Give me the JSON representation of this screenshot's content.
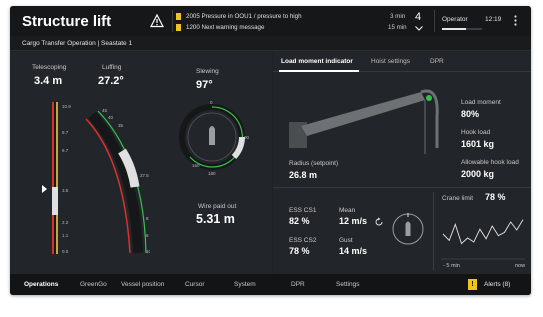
{
  "header": {
    "title": "Structure lift",
    "alerts": [
      {
        "text": "2005 Pressure in OOU1 / pressure to high",
        "time": "3 min"
      },
      {
        "text": "1200 Next warning message",
        "time": "15 min"
      }
    ],
    "alert_count": "4",
    "role": "Operator",
    "clock": "12:19"
  },
  "subheader": {
    "operation": "Cargo Transfer Operation | Seastate 1"
  },
  "telescoping": {
    "label": "Telescoping",
    "value": "3.4 m",
    "ticks": [
      "10.9",
      "8.7",
      "6.7",
      "3.5",
      "2.2",
      "1.1",
      "0.0"
    ]
  },
  "luffing": {
    "label": "Luffing",
    "value": "27.2°",
    "ticks": [
      "45",
      "40",
      "35",
      "27.5",
      "8",
      "6",
      "10"
    ]
  },
  "slewing": {
    "label": "Slewing",
    "value": "97°",
    "ticks": [
      "0",
      "90",
      "150",
      "180"
    ]
  },
  "wire": {
    "label": "Wire paid out",
    "value": "5.31 m"
  },
  "tabs": [
    {
      "label": "Load moment indicator",
      "active": true
    },
    {
      "label": "Hoist settings",
      "active": false
    },
    {
      "label": "DPR",
      "active": false
    }
  ],
  "load_moment": {
    "radius_label": "Radius (setpoint)",
    "radius_value": "26.8 m",
    "moment_label": "Load moment",
    "moment_value": "80%",
    "hook_label": "Hook load",
    "hook_value": "1601 kg",
    "allowable_label": "Allowable hook load",
    "allowable_value": "2000 kg"
  },
  "ess": {
    "cs1_label": "ESS CS1",
    "cs1_value": "82 %",
    "cs2_label": "ESS CS2",
    "cs2_value": "78 %"
  },
  "wind": {
    "mean_label": "Mean",
    "mean_value": "12 m/s",
    "gust_label": "Gust",
    "gust_value": "14 m/s"
  },
  "crane_limit": {
    "label": "Crane limit",
    "value": "78 %",
    "x_start": "- 5 min",
    "x_end": "now",
    "values": [
      60,
      52,
      72,
      48,
      55,
      50,
      66,
      54,
      70,
      58,
      62,
      75,
      65,
      78
    ]
  },
  "nav": {
    "items": [
      "Operations",
      "GreenGo",
      "Vessel position",
      "Cursor",
      "System",
      "DPR",
      "Settings"
    ],
    "active": "Operations",
    "alerts_label": "Alerts (8)",
    "alerts_icon": "!"
  },
  "colors": {
    "accent_yellow": "#f0c419",
    "ok_green": "#39c04c",
    "danger_red": "#d9322c",
    "bg": "#22262a"
  }
}
